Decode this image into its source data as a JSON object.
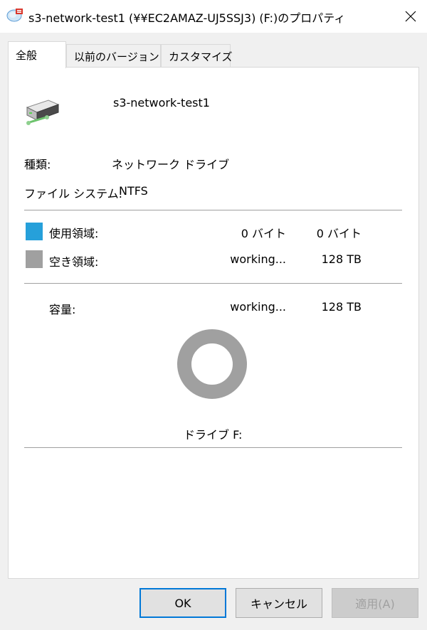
{
  "window": {
    "title": "s3-network-test1 (¥¥EC2AMAZ-UJ5SSJ3) (F:)のプロパティ",
    "close_icon": "close-icon"
  },
  "tabs": [
    {
      "label": "全般",
      "active": true
    },
    {
      "label": "以前のバージョン",
      "active": false
    },
    {
      "label": "カスタマイズ",
      "active": false
    }
  ],
  "general": {
    "drive_name": "s3-network-test1",
    "type_label": "種類:",
    "type_value": "ネットワーク ドライブ",
    "fs_label": "ファイル システム:",
    "fs_value": "NTFS",
    "used": {
      "label": "使用領域:",
      "bytes": "0 バイト",
      "size": "0 バイト",
      "color": "#26a0da"
    },
    "free": {
      "label": "空き領域:",
      "bytes": "working...",
      "size": "128 TB",
      "color": "#a0a0a0"
    },
    "capacity": {
      "label": "容量:",
      "bytes": "working...",
      "size": "128 TB"
    },
    "drive_label": "ドライブ F:"
  },
  "buttons": {
    "ok": "OK",
    "cancel": "キャンセル",
    "apply": "適用(A)"
  }
}
